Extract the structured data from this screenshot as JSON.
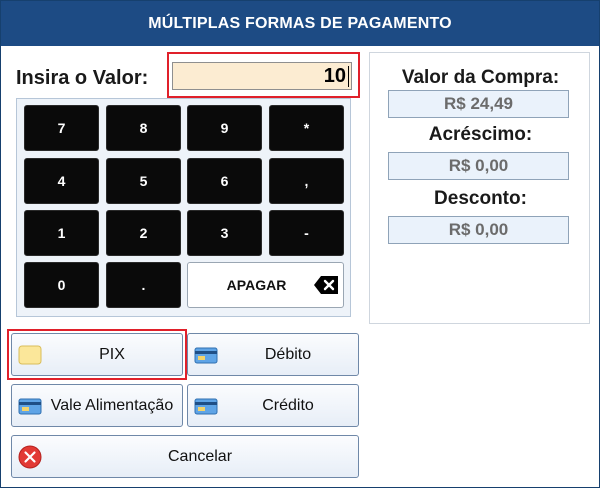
{
  "window": {
    "title": "MÚLTIPLAS FORMAS DE PAGAMENTO"
  },
  "input": {
    "label": "Insira o Valor:",
    "value": "10"
  },
  "keypad": {
    "keys": [
      "7",
      "8",
      "9",
      "*",
      "4",
      "5",
      "6",
      ",",
      "1",
      "2",
      "3",
      "-",
      "0",
      "."
    ],
    "apagar_label": "APAGAR",
    "apagar_icon": "backspace-icon"
  },
  "summary": {
    "purchase_label": "Valor da Compra:",
    "purchase_value": "R$ 24,49",
    "surcharge_label": "Acréscimo:",
    "surcharge_value": "R$ 0,00",
    "discount_label": "Desconto:",
    "discount_value": "R$ 0,00"
  },
  "payment_methods": {
    "pix": "PIX",
    "debit": "Débito",
    "meal_voucher": "Vale Alimentação",
    "credit": "Crédito",
    "cancel": "Cancelar"
  },
  "colors": {
    "title_bar": "#1d4b84",
    "highlight": "#e0202a",
    "input_background": "#fcecd2",
    "key_background": "#0a0a0a",
    "cancel_icon": "#e23a35"
  }
}
